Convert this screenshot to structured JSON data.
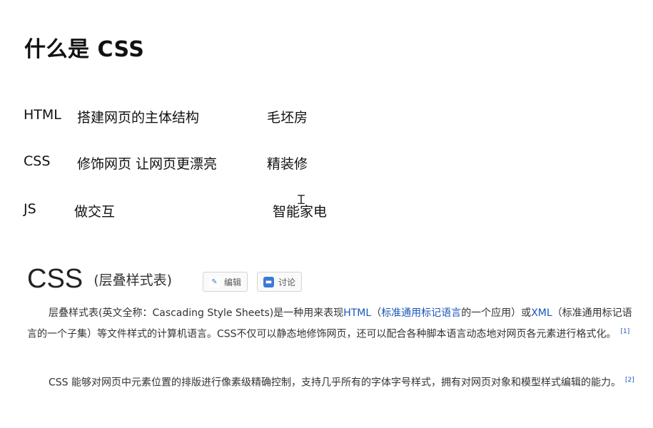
{
  "page_title": "什么是 CSS",
  "rows": [
    {
      "label": "HTML",
      "desc": "搭建网页的主体结构",
      "analogy": "毛坯房"
    },
    {
      "label": "CSS",
      "desc": "修饰网页  让网页更漂亮",
      "analogy": "精装修"
    },
    {
      "label": "JS",
      "desc": "做交互",
      "analogy": "智能家电"
    }
  ],
  "wiki": {
    "title": "CSS",
    "subtitle": "(层叠样式表)",
    "edit_label": "编辑",
    "discuss_label": "讨论",
    "p1": {
      "t1": "层叠样式表(英文全称：Cascading Style Sheets)是一种用来表现",
      "l1": "HTML",
      "t2": "（",
      "l2": "标准通用标记语言",
      "t3": "的一个应用）或",
      "l3": "XML",
      "t4": "（标准通用标记语言的一个子集）等文件样式的计算机语言。CSS不仅可以静态地修饰网页，还可以配合各种脚本语言动态地对网页各元素进行格式化。",
      "ref": "[1]"
    },
    "p2": {
      "text": "CSS 能够对网页中元素位置的排版进行像素级精确控制，支持几乎所有的字体字号样式，拥有对网页对象和模型样式编辑的能力。",
      "ref": "[2]"
    }
  }
}
